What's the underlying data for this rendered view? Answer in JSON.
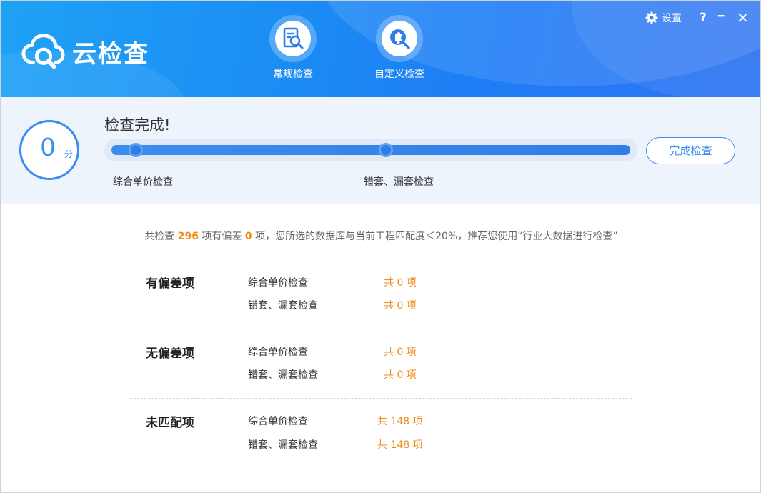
{
  "app": {
    "title": "云检查"
  },
  "nav": [
    {
      "label": "常规检查",
      "icon": "document-search-icon"
    },
    {
      "label": "自定义检查",
      "icon": "puzzle-search-icon"
    }
  ],
  "window_controls": {
    "settings_label": "设置",
    "help": "?",
    "minimize": "━",
    "close": "✕"
  },
  "progress": {
    "score": "0",
    "score_unit": "分",
    "status": "检查完成!",
    "percent": 100,
    "stages": [
      {
        "label": "综合单价检查"
      },
      {
        "label": "错套、漏套检查"
      }
    ],
    "finish_button": "完成检查"
  },
  "summary": {
    "prefix": "共检查",
    "total": "296",
    "mid1": "项有偏差",
    "deviated": "0",
    "suffix": "项，您所选的数据库与当前工程匹配度＜20%，推荐您使用“行业大数据进行检查”"
  },
  "groups": [
    {
      "title": "有偏差项",
      "rows": [
        {
          "name": "综合单价检查",
          "count": "共 0 项"
        },
        {
          "name": "错套、漏套检查",
          "count": "共 0 项"
        }
      ]
    },
    {
      "title": "无偏差项",
      "rows": [
        {
          "name": "综合单价检查",
          "count": "共 0 项"
        },
        {
          "name": "错套、漏套检查",
          "count": "共 0 项"
        }
      ]
    },
    {
      "title": "未匹配项",
      "rows": [
        {
          "name": "综合单价检查",
          "count": "共 148 项"
        },
        {
          "name": "错套、漏套检查",
          "count": "共 148 项"
        }
      ]
    }
  ],
  "colors": {
    "primary": "#3a8cf2",
    "accent": "#f08a18",
    "header": "#1f8af4",
    "panel": "#eef4fc"
  }
}
